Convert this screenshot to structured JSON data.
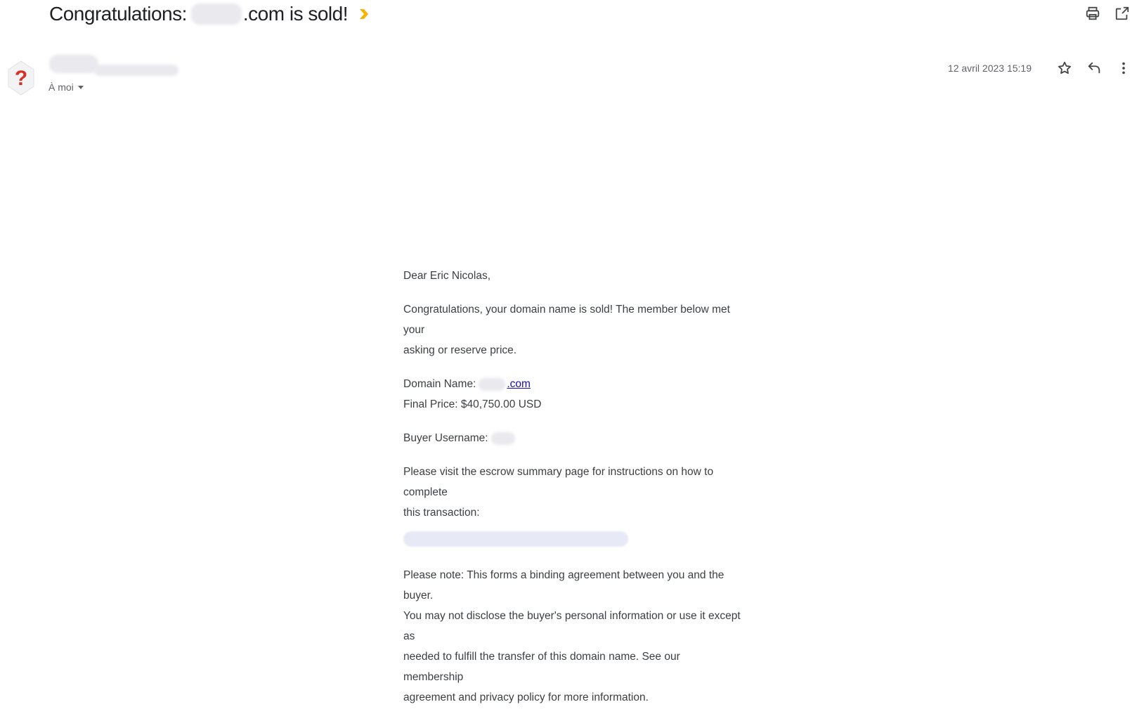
{
  "email": {
    "subject_prefix": "Congratulations:",
    "subject_suffix": ".com is sold!",
    "to_label": "À moi",
    "date": "12 avril 2023 15:19",
    "avatar_glyph": "?"
  },
  "icons": {
    "importance": "importance-marker-icon",
    "print": "print-icon",
    "open_new_window": "open-in-new-window-icon",
    "star": "star-icon",
    "reply": "reply-icon",
    "more": "more-vertical-icon"
  },
  "body": {
    "greeting": "Dear Eric Nicolas,",
    "para1_line1": "Congratulations, your domain name is sold! The member below met your",
    "para1_line2": "asking or reserve price.",
    "domain_label": "Domain Name:",
    "domain_link_suffix": ".com",
    "final_price": "Final Price: $40,750.00 USD",
    "buyer_label": "Buyer Username:",
    "visit_line1": "Please visit the escrow summary page for instructions on how to complete",
    "visit_line2": "this transaction:",
    "note_line1": "Please note: This forms a binding agreement between you and the buyer.",
    "note_line2": "You may not disclose the buyer's personal information or use it except as",
    "note_line3": "needed to fulfill the transfer of this domain name. See our membership",
    "note_line4": "agreement and privacy policy for more information."
  },
  "colors": {
    "importance": "#f4b400",
    "avatar_bg": "#f1f3f4",
    "avatar_glyph": "#d93025",
    "link": "#1a0dab",
    "icon": "#444746"
  }
}
